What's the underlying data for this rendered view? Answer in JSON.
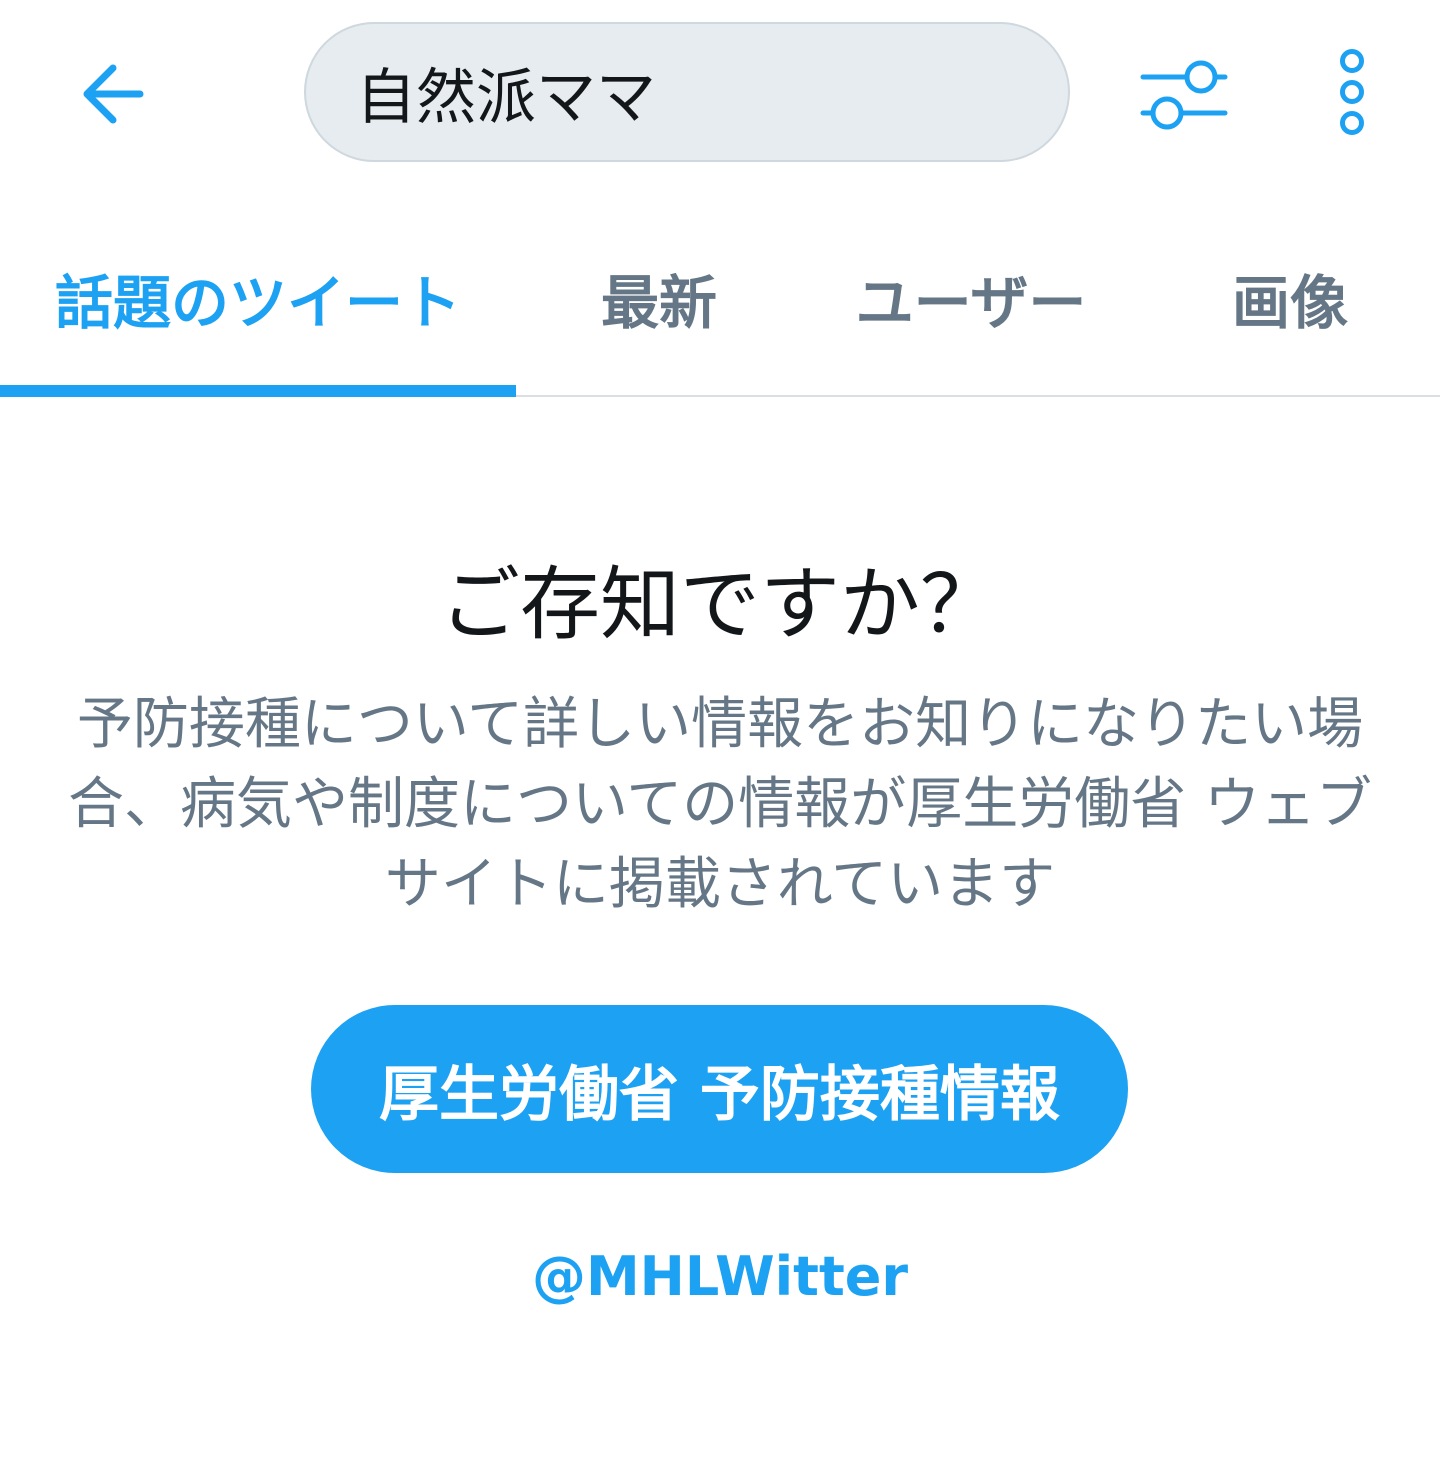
{
  "colors": {
    "accent": "#1da1f2",
    "secondary_text": "#657786",
    "primary_text": "#14171a",
    "search_bg": "#e6ecf0",
    "divider": "#d9dfe3"
  },
  "header": {
    "back_icon": "arrow-left-icon",
    "search_query": "自然派ママ",
    "filter_icon": "sliders-icon",
    "more_icon": "vertical-dots-icon"
  },
  "tabs": [
    {
      "label": "話題のツイート",
      "active": true
    },
    {
      "label": "最新",
      "active": false
    },
    {
      "label": "ユーザー",
      "active": false
    },
    {
      "label": "画像",
      "active": false
    }
  ],
  "notice": {
    "title": "ご存知ですか？",
    "body": "予防接種について詳しい情報をお知りになりたい場合、病気や制度についての情報が厚生労働省 ウェブサイトに掲載されています",
    "button_label": "厚生労働省 予防接種情報",
    "handle": "@MHLWitter"
  }
}
